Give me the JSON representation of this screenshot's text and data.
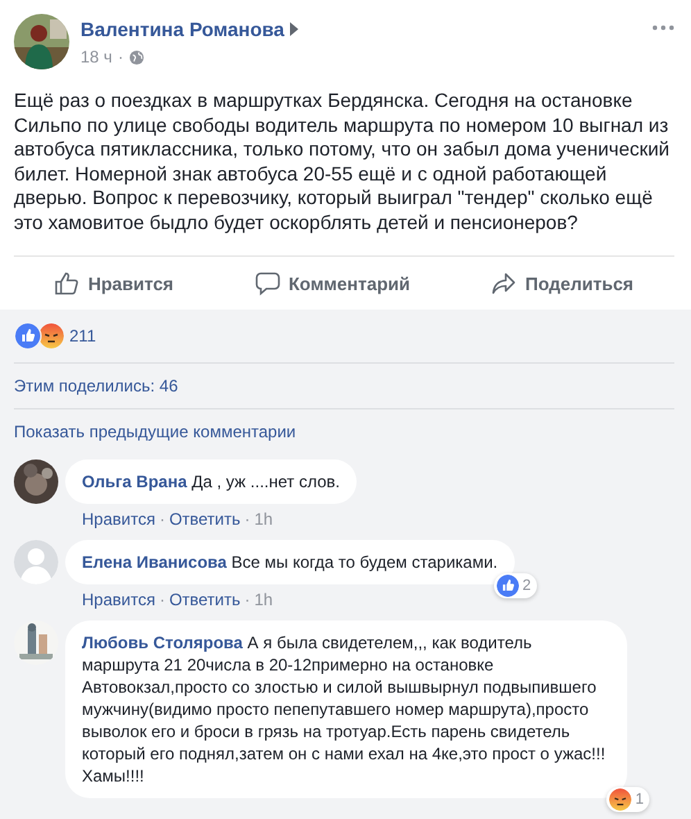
{
  "post": {
    "author": "Валентина Романова",
    "time": "18 ч",
    "separator": "·",
    "text": "Ещё раз о поездках в маршрутках Бердянска. Сегодня на остановке Сильпо по улице свободы водитель маршрута по номером 10 выгнал из автобуса пятиклассника, только потому, что он забыл дома ученический билет. Номерной знак автобуса 20-55 ещё и с одной работающей дверью. Вопрос к перевозчику, который выиграл \"тендер\" сколько ещё это хамовитое быдло будет оскорблять детей и пенсионеров?",
    "actions": [
      {
        "kind": "like",
        "label": "Нравится"
      },
      {
        "kind": "comment",
        "label": "Комментарий"
      },
      {
        "kind": "share",
        "label": "Поделиться"
      }
    ]
  },
  "reactions": {
    "types": [
      {
        "kind": "like"
      },
      {
        "kind": "angry"
      }
    ],
    "count": "211"
  },
  "shares": "Этим поделились: 46",
  "show_previous": "Показать предыдущие комментарии",
  "comments": [
    {
      "author": "Ольга Врана",
      "text": "Да , уж ....нет слов.",
      "separator": "·",
      "actions": [
        "Нравится",
        "Ответить",
        "1h"
      ]
    },
    {
      "author": "Елена Иванисова",
      "text": "Все мы когда то будем стариками.",
      "avatar": {
        "kind": "default"
      },
      "reaction": {
        "kind": "like",
        "count": "2"
      },
      "separator": "·",
      "actions": [
        "Нравится",
        "Ответить",
        "1h"
      ]
    },
    {
      "author": "Любовь Столярова",
      "text": "А я была свидетелем,,, как водитель маршрута 21 20числа в 20-12примерно на остановке Автовокзал,просто со злостью и силой вышвырнул подвыпившего мужчину(видимо просто пепепутавшего номер маршрута),просто выволок его и броси в грязь на тротуар.Есть парень свидетель который его поднял,затем он с нами ехал на 4ке,это прост о ужас!!!Хамы!!!!",
      "reaction": {
        "kind": "angry",
        "count": "1"
      }
    }
  ]
}
